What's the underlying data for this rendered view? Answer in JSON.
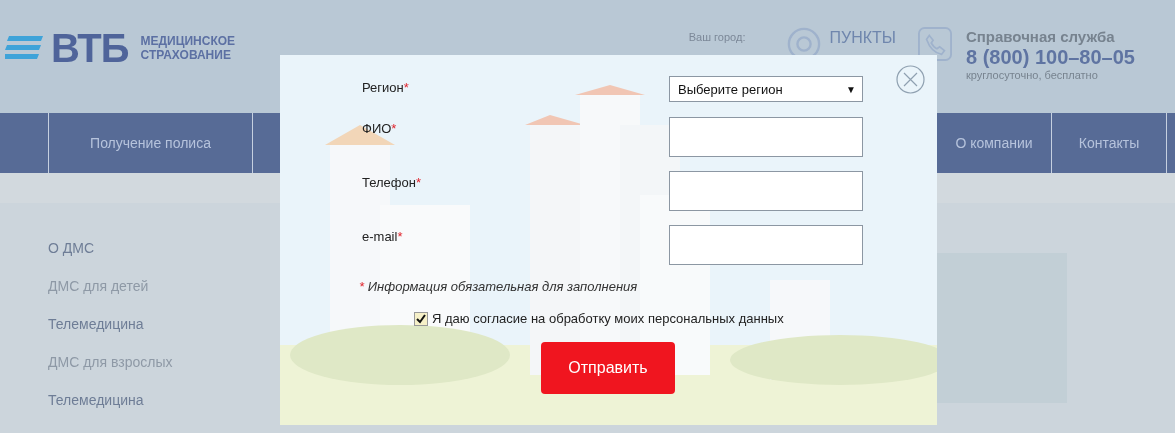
{
  "header": {
    "logo": {
      "mark": "ВТБ",
      "line1": "МЕДИЦИНСКОЕ",
      "line2": "СТРАХОВАНИЕ"
    },
    "city_label": "Ваш город:",
    "pickup": "ПУНКТЫ",
    "help": {
      "title": "Справочная служба",
      "phone": "8 (800) 100–80–05",
      "note": "круглосуточно, бесплатно"
    }
  },
  "nav": {
    "left": [
      {
        "label": "Получение полиса"
      }
    ],
    "right": [
      {
        "label": "О компании"
      },
      {
        "label": "Контакты"
      }
    ]
  },
  "sidebar": [
    {
      "label": "О ДМС",
      "dimmed": false
    },
    {
      "label": "ДМС для детей",
      "dimmed": true
    },
    {
      "label": "Телемедицина",
      "dimmed": false
    },
    {
      "label": "ДМС для взрослых",
      "dimmed": true
    },
    {
      "label": "Телемедицина",
      "dimmed": false
    }
  ],
  "modal": {
    "fields": [
      {
        "label": "Регион",
        "mark": "*",
        "kind": "select",
        "value": "Выберите регион",
        "caret": "▼"
      },
      {
        "label": "ФИО",
        "mark": "*",
        "kind": "text"
      },
      {
        "label": "Телефон",
        "mark": "*",
        "kind": "text"
      },
      {
        "label": "e-mail",
        "mark": "*",
        "kind": "text"
      }
    ],
    "note": {
      "mark": "*",
      "text": "Информация обязательная для заполнения"
    },
    "consent": {
      "label": "Я даю согласие на обработку моих персональных данных",
      "checked": true
    },
    "submit": "Отправить"
  }
}
